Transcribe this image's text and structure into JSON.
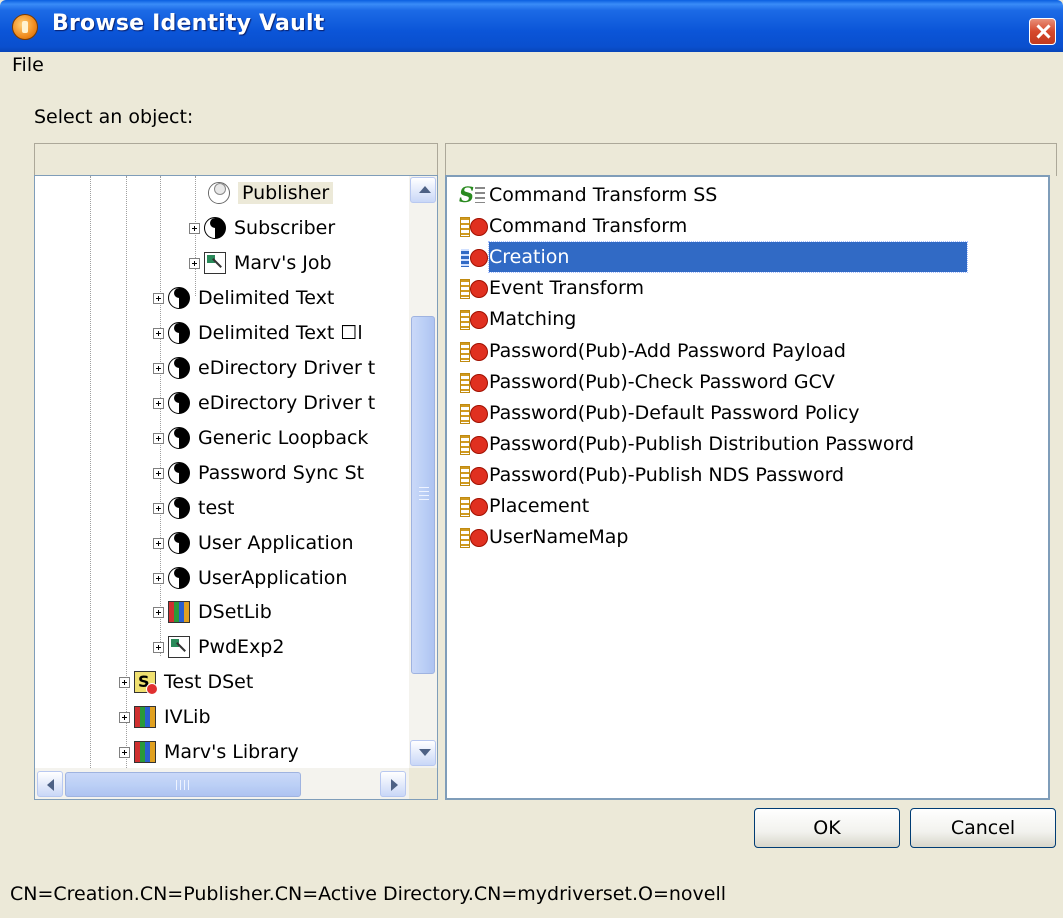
{
  "window": {
    "title": "Browse Identity Vault"
  },
  "menu": {
    "file": "File"
  },
  "prompt": "Select an object:",
  "tree": {
    "items": [
      {
        "label": "Publisher",
        "icon": "yin-yang-outline-icon",
        "expander": false,
        "selected": true
      },
      {
        "label": "Subscriber",
        "icon": "yin-yang-icon",
        "expander": true
      },
      {
        "label": "Marv's Job",
        "icon": "job-icon",
        "expander": true
      },
      {
        "label": "Delimited Text",
        "icon": "yin-yang-icon",
        "expander": true
      },
      {
        "label": "Delimited Text ☐l",
        "icon": "yin-yang-icon",
        "expander": true
      },
      {
        "label": "eDirectory Driver t",
        "icon": "yin-yang-icon",
        "expander": true
      },
      {
        "label": "eDirectory Driver t",
        "icon": "yin-yang-icon",
        "expander": true
      },
      {
        "label": "Generic Loopback",
        "icon": "yin-yang-icon",
        "expander": true
      },
      {
        "label": "Password Sync St",
        "icon": "yin-yang-icon",
        "expander": true
      },
      {
        "label": "test",
        "icon": "yin-yang-icon",
        "expander": true
      },
      {
        "label": "User Application",
        "icon": "yin-yang-icon",
        "expander": true
      },
      {
        "label": "UserApplication",
        "icon": "yin-yang-icon",
        "expander": true
      },
      {
        "label": "DSetLib",
        "icon": "library-icon",
        "expander": true
      },
      {
        "label": "PwdExp2",
        "icon": "job-icon",
        "expander": true
      },
      {
        "label": "Test DSet",
        "icon": "driver-set-icon",
        "expander": true
      },
      {
        "label": "IVLib",
        "icon": "library-icon",
        "expander": true
      },
      {
        "label": "Marv's Library",
        "icon": "library-icon",
        "expander": true
      }
    ]
  },
  "list": {
    "items": [
      {
        "label": "Command Transform SS",
        "icon": "stylesheet-icon"
      },
      {
        "label": "Command Transform",
        "icon": "policy-icon"
      },
      {
        "label": "Creation",
        "icon": "policy-icon",
        "selected": true
      },
      {
        "label": "Event Transform",
        "icon": "policy-icon"
      },
      {
        "label": "Matching",
        "icon": "policy-icon"
      },
      {
        "label": "Password(Pub)-Add Password Payload",
        "icon": "policy-icon"
      },
      {
        "label": "Password(Pub)-Check Password GCV",
        "icon": "policy-icon"
      },
      {
        "label": "Password(Pub)-Default Password Policy",
        "icon": "policy-icon"
      },
      {
        "label": "Password(Pub)-Publish Distribution Password",
        "icon": "policy-icon"
      },
      {
        "label": "Password(Pub)-Publish NDS Password",
        "icon": "policy-icon"
      },
      {
        "label": "Placement",
        "icon": "policy-icon"
      },
      {
        "label": "UserNameMap",
        "icon": "policy-icon"
      }
    ]
  },
  "buttons": {
    "ok": "OK",
    "cancel": "Cancel"
  },
  "status": "CN=Creation.CN=Publisher.CN=Active Directory.CN=mydriverset.O=novell",
  "colors": {
    "titlebar": "#0b55d8",
    "selection": "#316ac5",
    "window_bg": "#ece9d8"
  }
}
